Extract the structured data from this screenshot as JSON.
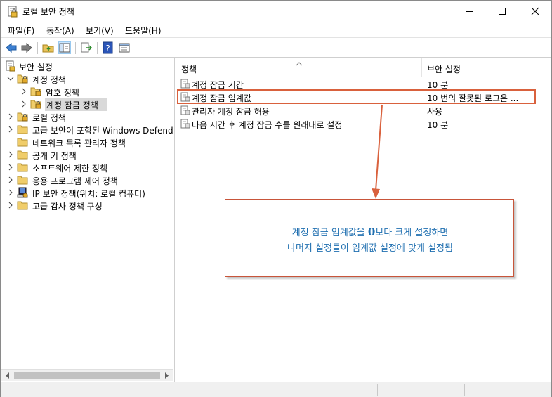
{
  "window": {
    "title": "로컬 보안 정책"
  },
  "menu": [
    "파일(F)",
    "동작(A)",
    "보기(V)",
    "도움말(H)"
  ],
  "toolbar_icons": [
    "back-icon",
    "forward-icon",
    "up-folder-icon",
    "show-hide-tree-icon",
    "export-list-icon",
    "help-icon",
    "properties-icon"
  ],
  "tree": {
    "root": "보안 설정",
    "items": [
      {
        "label": "계정 정책",
        "expanded": true
      },
      {
        "label": "암호 정책"
      },
      {
        "label": "계정 잠금 정책",
        "selected": true
      },
      {
        "label": "로컬 정책"
      },
      {
        "label": "고급 보안이 포함된 Windows Defender"
      },
      {
        "label": "네트워크 목록 관리자 정책"
      },
      {
        "label": "공개 키 정책"
      },
      {
        "label": "소프트웨어 제한 정책"
      },
      {
        "label": "응용 프로그램 제어 정책"
      },
      {
        "label": "IP 보안 정책(위치: 로컬 컴퓨터)"
      },
      {
        "label": "고급 감사 정책 구성"
      }
    ]
  },
  "list": {
    "columns": [
      "정책",
      "보안 설정"
    ],
    "rows": [
      {
        "policy": "계정 잠금 기간",
        "value": "10 분"
      },
      {
        "policy": "계정 잠금 임계값",
        "value": "10 번의 잘못된 로그온 ..."
      },
      {
        "policy": "관리자 계정 잠금 허용",
        "value": "사용"
      },
      {
        "policy": "다음 시간 후 계정 잠금 수를 원래대로 설정",
        "value": "10 분"
      }
    ]
  },
  "callout": {
    "line1_a": "계정 잠금 임계값을 ",
    "line1_num": "0",
    "line1_b": "보다 크게 설정하면",
    "line2": "나머지 설정들이 임계값 설정에 맞게 설정됨"
  },
  "colors": {
    "callout_text": "#1f6fb0",
    "callout_border": "#c8553a",
    "highlight_border": "#d9613d",
    "selected_bg": "#d9d9d9"
  }
}
